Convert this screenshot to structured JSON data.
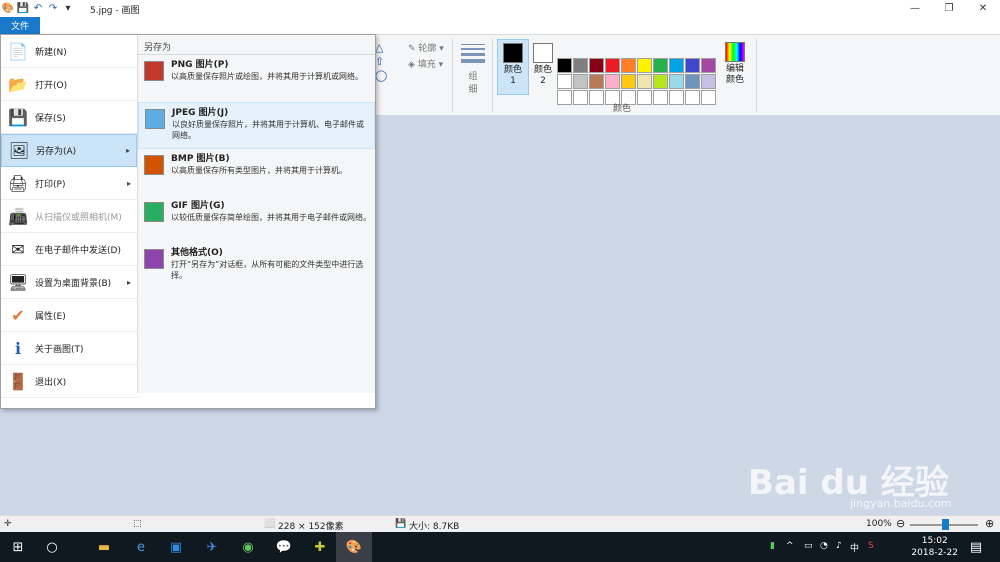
{
  "titlebar": {
    "doc_title": "5.jpg - 画图",
    "qat_icons": [
      "paint-app-icon",
      "save-icon",
      "undo-icon",
      "redo-icon",
      "customize-dropdown-icon"
    ]
  },
  "ribbon": {
    "file_tab": "文件",
    "outline_label": "轮廓",
    "fill_label": "填充",
    "size_label": "组\n细",
    "color1_label": "颜色 1",
    "color2_label": "颜色 2",
    "edit_colors_label": "编辑颜色",
    "colors_group_label": "颜色",
    "color1": "#000000",
    "color2": "#ffffff",
    "palette": [
      "#000000",
      "#7f7f7f",
      "#880015",
      "#ed1c24",
      "#ff7f27",
      "#fff200",
      "#22b14c",
      "#00a2e8",
      "#3f48cc",
      "#a349a4",
      "#ffffff",
      "#c3c3c3",
      "#b97a57",
      "#ffaec9",
      "#ffc90e",
      "#efe4b0",
      "#b5e61d",
      "#99d9ea",
      "#7092be",
      "#c8bfe7",
      "#ffffff",
      "#ffffff",
      "#ffffff",
      "#ffffff",
      "#ffffff",
      "#ffffff",
      "#ffffff",
      "#ffffff",
      "#ffffff",
      "#ffffff"
    ]
  },
  "file_menu": {
    "items": [
      {
        "label": "新建(N)",
        "icon": "new-file-icon",
        "arrow": false,
        "disabled": false,
        "selected": false
      },
      {
        "label": "打开(O)",
        "icon": "open-folder-icon",
        "arrow": false,
        "disabled": false,
        "selected": false
      },
      {
        "label": "保存(S)",
        "icon": "save-icon",
        "arrow": false,
        "disabled": false,
        "selected": false
      },
      {
        "label": "另存为(A)",
        "icon": "save-as-icon",
        "arrow": true,
        "disabled": false,
        "selected": true
      },
      {
        "label": "打印(P)",
        "icon": "printer-icon",
        "arrow": true,
        "disabled": false,
        "selected": false
      },
      {
        "label": "从扫描仪或照相机(M)",
        "icon": "scanner-icon",
        "arrow": false,
        "disabled": true,
        "selected": false
      },
      {
        "label": "在电子邮件中发送(D)",
        "icon": "email-icon",
        "arrow": false,
        "disabled": false,
        "selected": false
      },
      {
        "label": "设置为桌面背景(B)",
        "icon": "desktop-icon",
        "arrow": true,
        "disabled": false,
        "selected": false
      },
      {
        "label": "属性(E)",
        "icon": "checkmark-icon",
        "arrow": false,
        "disabled": false,
        "selected": false
      },
      {
        "label": "关于画图(T)",
        "icon": "info-icon",
        "arrow": false,
        "disabled": false,
        "selected": false
      },
      {
        "label": "退出(X)",
        "icon": "exit-icon",
        "arrow": false,
        "disabled": false,
        "selected": false
      }
    ],
    "submenu": {
      "header": "另存为",
      "items": [
        {
          "title": "PNG 图片(P)",
          "desc": "以高质量保存照片或绘图，并将其用于计算机或网络。",
          "icon": "png-image-icon",
          "color": "#c0392b",
          "hover": false
        },
        {
          "title": "JPEG 图片(J)",
          "desc": "以良好质量保存照片，并将其用于计算机、电子邮件或网络。",
          "icon": "jpeg-image-icon",
          "color": "#5dade2",
          "hover": true
        },
        {
          "title": "BMP 图片(B)",
          "desc": "以高质量保存所有类型图片，并将其用于计算机。",
          "icon": "bmp-image-icon",
          "color": "#d35400",
          "hover": false
        },
        {
          "title": "GIF 图片(G)",
          "desc": "以较低质量保存简单绘图，并将其用于电子邮件或网络。",
          "icon": "gif-image-icon",
          "color": "#27ae60",
          "hover": false
        },
        {
          "title": "其他格式(O)",
          "desc": "打开“另存为”对话框，从所有可能的文件类型中进行选择。",
          "icon": "other-formats-icon",
          "color": "#8e44ad",
          "hover": false
        }
      ]
    }
  },
  "statusbar": {
    "dimensions": "228 × 152像素",
    "size": "大小: 8.7KB",
    "zoom": "100%"
  },
  "taskbar": {
    "ime": "中",
    "time": "15:02",
    "date": "2018-2-22",
    "notification_count": "1"
  },
  "watermark": {
    "text": "Bai du 经验",
    "sub": "jingyan.baidu.com"
  }
}
